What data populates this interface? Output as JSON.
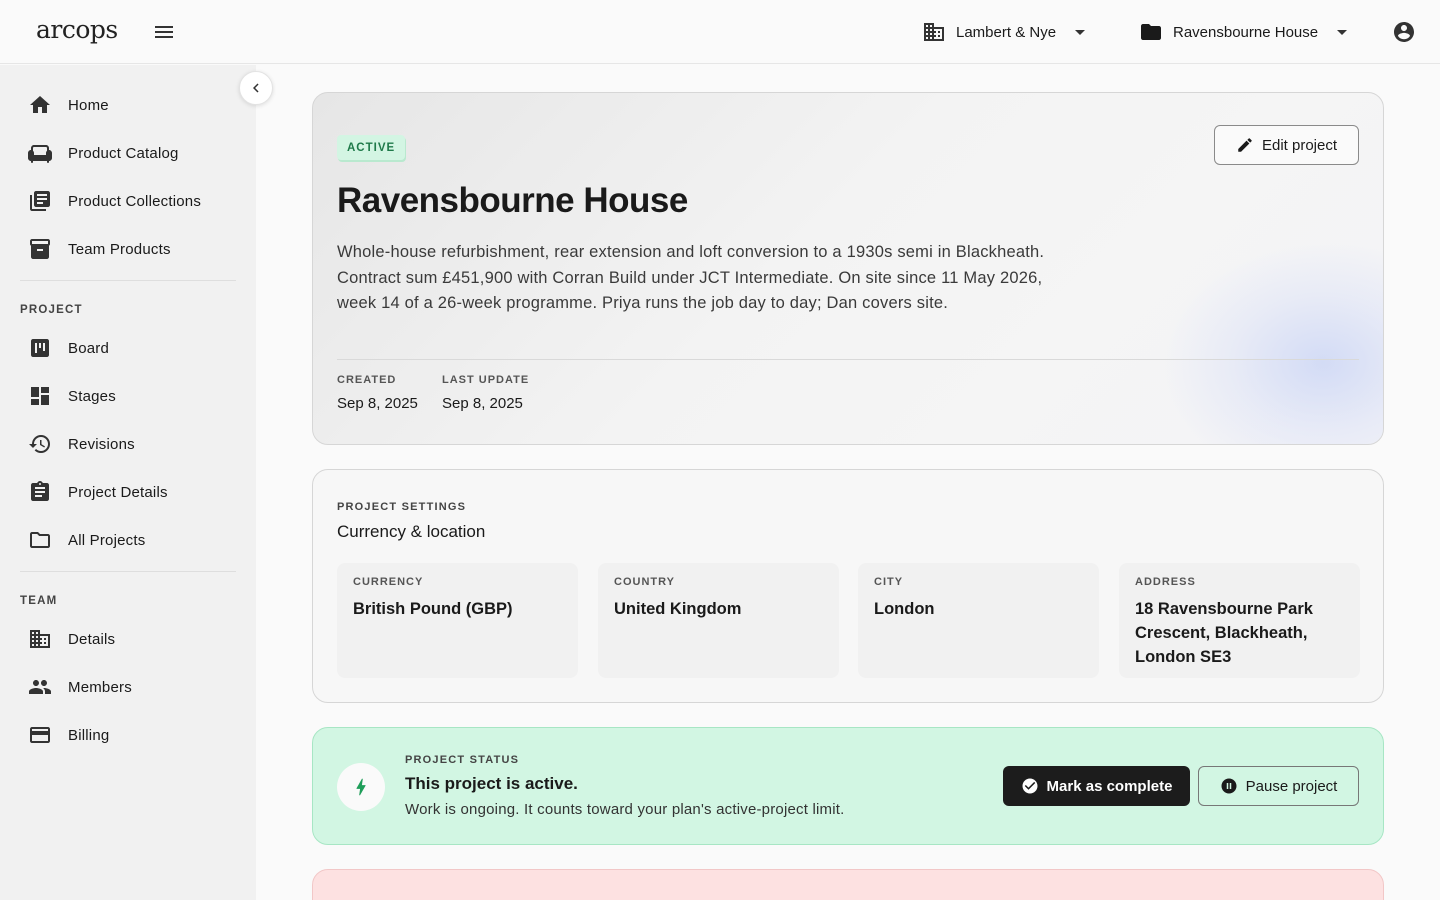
{
  "app": {
    "logo": "arcops"
  },
  "header": {
    "team_selector": {
      "label": "Lambert & Nye",
      "icon": "business-icon"
    },
    "project_selector": {
      "label": "Ravensbourne House",
      "icon": "folder-icon"
    },
    "account_icon": "account-circle-icon"
  },
  "sidebar": {
    "primary": [
      {
        "label": "Home",
        "icon": "home-icon"
      },
      {
        "label": "Product Catalog",
        "icon": "sofa-icon"
      },
      {
        "label": "Product Collections",
        "icon": "library-icon"
      },
      {
        "label": "Team Products",
        "icon": "inventory-icon"
      }
    ],
    "project_heading": "PROJECT",
    "project": [
      {
        "label": "Board",
        "icon": "kanban-icon"
      },
      {
        "label": "Stages",
        "icon": "dashboard-icon"
      },
      {
        "label": "Revisions",
        "icon": "history-icon"
      },
      {
        "label": "Project Details",
        "icon": "assignment-icon"
      },
      {
        "label": "All Projects",
        "icon": "folder-outline-icon"
      }
    ],
    "team_heading": "TEAM",
    "team": [
      {
        "label": "Details",
        "icon": "building-icon"
      },
      {
        "label": "Members",
        "icon": "people-icon"
      },
      {
        "label": "Billing",
        "icon": "credit-card-icon"
      }
    ]
  },
  "hero": {
    "badge": "ACTIVE",
    "title": "Ravensbourne House",
    "description": "Whole-house refurbishment, rear extension and loft conversion to a 1930s semi in Blackheath. Contract sum £451,900 with Corran Build under JCT Intermediate. On site since 11 May 2026, week 14 of a 26-week programme. Priya runs the job day to day; Dan covers site.",
    "edit_label": "Edit project",
    "created_label": "CREATED",
    "created_value": "Sep 8, 2025",
    "updated_label": "LAST UPDATE",
    "updated_value": "Sep 8, 2025",
    "colors": {
      "badge_bg": "#d3f5e3",
      "badge_text": "#1f7a4a"
    }
  },
  "settings": {
    "eyebrow": "PROJECT SETTINGS",
    "title": "Currency & location",
    "fields": [
      {
        "label": "CURRENCY",
        "value": "British Pound (GBP)"
      },
      {
        "label": "COUNTRY",
        "value": "United Kingdom"
      },
      {
        "label": "CITY",
        "value": "London"
      },
      {
        "label": "ADDRESS",
        "value": "18 Ravensbourne Park Crescent, Blackheath, London SE3"
      }
    ]
  },
  "status": {
    "eyebrow": "PROJECT STATUS",
    "heading": "This project is active.",
    "description": "Work is ongoing. It counts toward your plan's active-project limit.",
    "complete_label": "Mark as complete",
    "pause_label": "Pause project",
    "colors": {
      "bg": "#d2f6e3",
      "accent": "#1f9e5a"
    }
  },
  "danger": {
    "colors": {
      "bg": "#fde1e1"
    }
  }
}
